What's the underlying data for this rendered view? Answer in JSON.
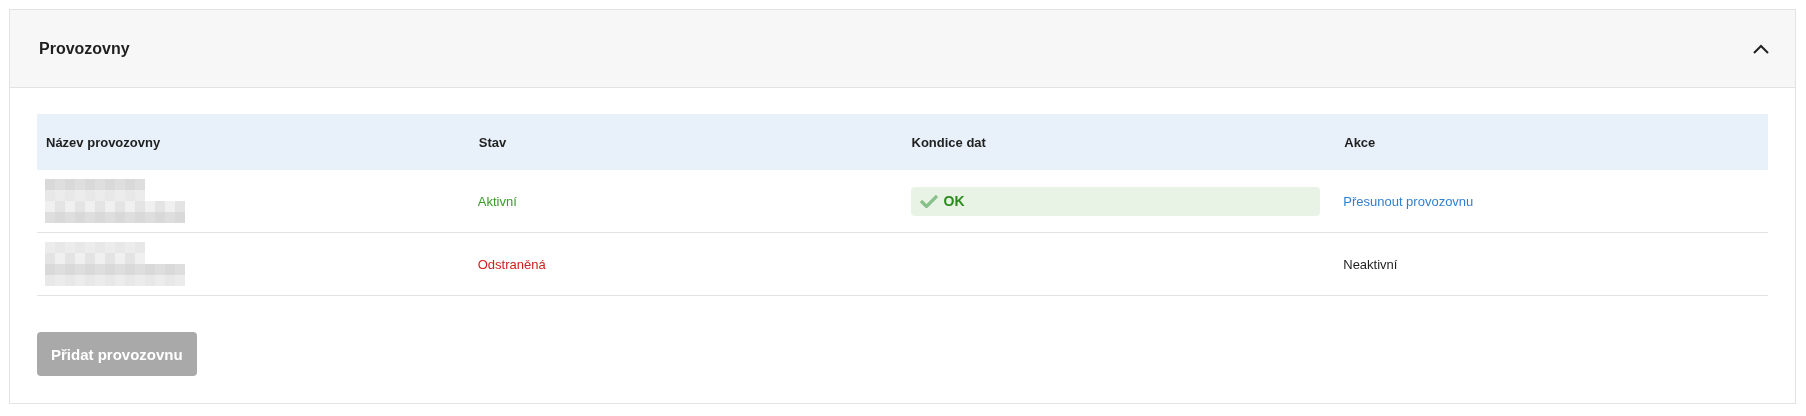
{
  "section": {
    "title": "Provozovny",
    "expanded": true,
    "table": {
      "columns": [
        "Název provozovny",
        "Stav",
        "Kondice dat",
        "Akce"
      ],
      "rows": [
        {
          "name": {
            "kind": "redacted"
          },
          "status": {
            "label": "Aktivní",
            "kind": "active"
          },
          "condition": {
            "kind": "ok",
            "label": "OK"
          },
          "action": {
            "kind": "link",
            "label": "Přesunout provozovnu"
          }
        },
        {
          "name": {
            "kind": "redacted"
          },
          "status": {
            "label": "Odstraněná",
            "kind": "removed"
          },
          "action": {
            "kind": "text",
            "label": "Neaktivní"
          }
        }
      ]
    },
    "add_button": {
      "label": "Přidat provozovnu",
      "disabled": true
    }
  }
}
